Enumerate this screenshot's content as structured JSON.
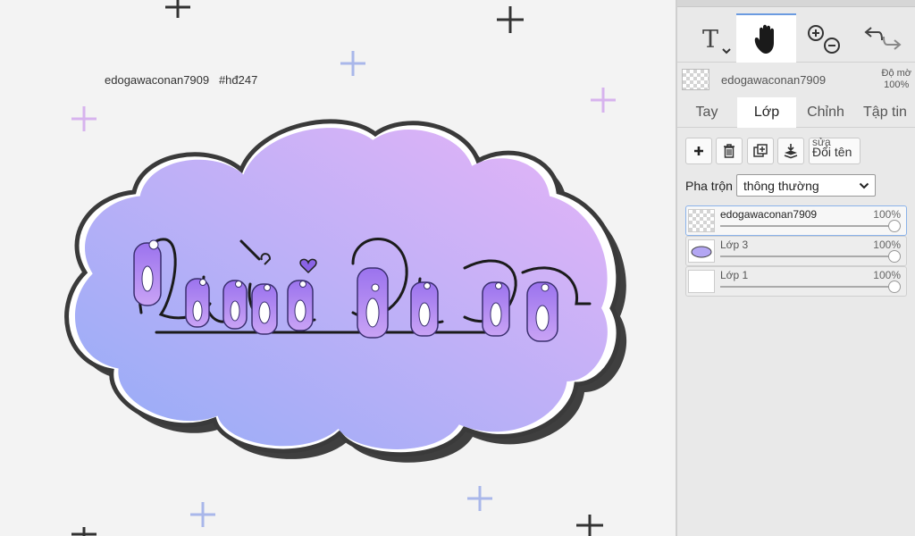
{
  "canvas": {
    "watermark": "edogawaconan7909   #hđ247",
    "colors": {
      "cloud_left": "#9fb2f7",
      "cloud_right": "#e0b6f7",
      "cloud_outline": "#3a3a3a",
      "letter_purple": "#8a63e6",
      "plus_dark": "#333333",
      "plus_blue": "#a9b7ea",
      "plus_pink": "#d7b3ee"
    }
  },
  "toolbar": {
    "tools": [
      {
        "name": "text-tool",
        "icon": "text-T-icon"
      },
      {
        "name": "hand-tool",
        "icon": "hand-icon",
        "active": true
      },
      {
        "name": "zoom-tool",
        "icon": "zoom-in-out-icon"
      },
      {
        "name": "undo-redo",
        "icon": "undo-redo-icon"
      }
    ],
    "text_glyph": "T"
  },
  "current_layer": {
    "name": "edogawaconan7909",
    "opacity_label": "Độ mờ",
    "opacity_value": "100%"
  },
  "tabs": [
    {
      "label": "Tay"
    },
    {
      "label": "Lớp",
      "active": true
    },
    {
      "label": "Chỉnh"
    },
    {
      "label": "Tập tin"
    }
  ],
  "layer_actions": {
    "rename_small": "sửa",
    "rename_label": "Đổi tên"
  },
  "blend": {
    "label": "Pha trộn",
    "value": "thông thường"
  },
  "layers": [
    {
      "name": "edogawaconan7909",
      "opacity": "100%",
      "active": true
    },
    {
      "name": "Lớp 3",
      "opacity": "100%"
    },
    {
      "name": "Lớp 1",
      "opacity": "100%"
    }
  ],
  "accent_color": "#6b9be0"
}
